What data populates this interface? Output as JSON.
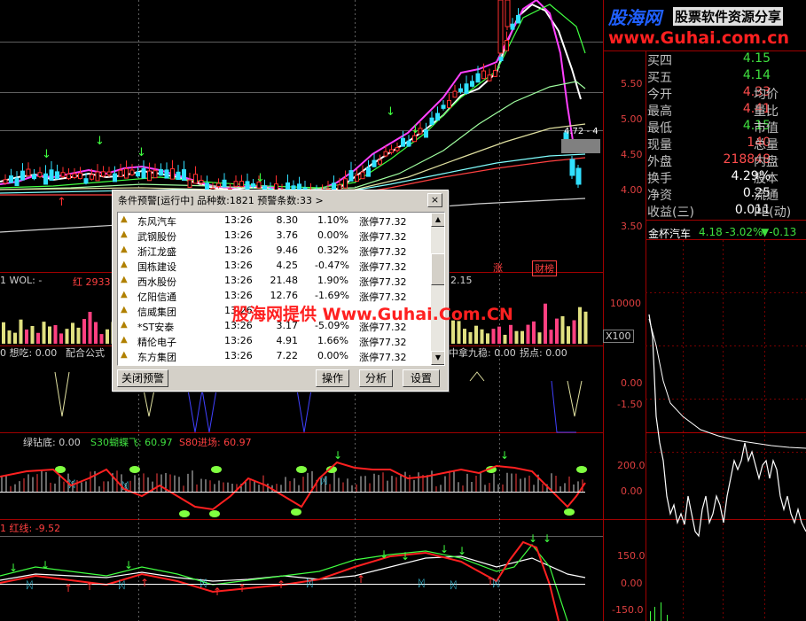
{
  "brand": {
    "logo_main": "股海网",
    "logo_sub": "股票软件资源分享",
    "url": "www.Guhai.com.cn",
    "watermark": "股海网提供 Www.Guhai.Com.CN"
  },
  "price_axis": [
    "5.50",
    "5.00",
    "4.50",
    "4.00",
    "3.50"
  ],
  "price_tag": "4.72 - 4",
  "volume_axis": [
    "10000",
    "X100"
  ],
  "vol_label": "1 WOL: -",
  "vol_red_label": "红 2933",
  "vol_right_value": "2.15",
  "tag_zhang": "涨",
  "tag_caifubang": "财榜",
  "ind1": {
    "label1": "0 想吃: 0.00",
    "label2": "配合公式",
    "label_right_a": "中拿九稳: 0.00",
    "label_right_b": "拐点: 0.00",
    "axis": [
      "0.00",
      "-1.50"
    ]
  },
  "ind2": {
    "label1": "绿钻底: 0.00",
    "label2": "S30蝴蝶飞: 60.97",
    "label3": "S80进场: 60.97",
    "axis": [
      "200.0",
      "0.00"
    ]
  },
  "ind3": {
    "label1": "1 红线: -9.52",
    "axis": [
      "150.0",
      "0.00",
      "-150.0"
    ]
  },
  "quote": {
    "rows": [
      {
        "k": "买四",
        "v": "4.15",
        "vc": "green",
        "k2": "",
        "v2": ""
      },
      {
        "k": "买五",
        "v": "4.14",
        "vc": "green",
        "k2": "",
        "v2": ""
      },
      {
        "k": "今开",
        "v": "4.33",
        "vc": "red",
        "k2": "均价",
        "v2": ""
      },
      {
        "k": "最高",
        "v": "4.41",
        "vc": "red",
        "k2": "量比",
        "v2": ""
      },
      {
        "k": "最低",
        "v": "4.15",
        "vc": "green",
        "k2": "市值",
        "v2": ""
      },
      {
        "k": "现量",
        "v": "140",
        "vc": "red",
        "k2": "总量",
        "v2": ""
      },
      {
        "k": "外盘",
        "v": "218848",
        "vc": "red",
        "k2": "内盘",
        "v2": ""
      },
      {
        "k": "换手",
        "v": "4.29%",
        "vc": "white",
        "k2": "股本",
        "v2": ""
      },
      {
        "k": "净资",
        "v": "0.25",
        "vc": "white",
        "k2": "流通",
        "v2": ""
      },
      {
        "k": "收益(三)",
        "v": "0.011",
        "vc": "white",
        "k2": "PE(动)",
        "v2": ""
      }
    ],
    "mini_title": "金杯汽车",
    "mini_price": "4.18",
    "mini_change": "-3.02%",
    "mini_delta": "▼-0.13"
  },
  "dialog": {
    "title": "条件预警[运行中] 品种数:1821 预警条数:33  >",
    "close": "×",
    "rows": [
      {
        "name": "东风汽车",
        "time": "13:26",
        "price": "8.30",
        "pct": "1.10%",
        "cond": "涨停77.32"
      },
      {
        "name": "武钢股份",
        "time": "13:26",
        "price": "3.76",
        "pct": "0.00%",
        "cond": "涨停77.32"
      },
      {
        "name": "浙江龙盛",
        "time": "13:26",
        "price": "9.46",
        "pct": "0.32%",
        "cond": "涨停77.32"
      },
      {
        "name": "国栋建设",
        "time": "13:26",
        "price": "4.25",
        "pct": "-0.47%",
        "cond": "涨停77.32"
      },
      {
        "name": "西水股份",
        "time": "13:26",
        "price": "21.48",
        "pct": "1.90%",
        "cond": "涨停77.32"
      },
      {
        "name": "亿阳信通",
        "time": "13:26",
        "price": "12.76",
        "pct": "-1.69%",
        "cond": "涨停77.32"
      },
      {
        "name": "信威集团",
        "time": "13:26",
        "price": "",
        "pct": "",
        "cond": ""
      },
      {
        "name": "*ST安泰",
        "time": "13:26",
        "price": "3.17",
        "pct": "-5.09%",
        "cond": "涨停77.32"
      },
      {
        "name": "精伦电子",
        "time": "13:26",
        "price": "4.91",
        "pct": "1.66%",
        "cond": "涨停77.32"
      },
      {
        "name": "东方集团",
        "time": "13:26",
        "price": "7.22",
        "pct": "0.00%",
        "cond": "涨停77.32"
      }
    ],
    "btn_close": "关闭预警",
    "btn_op": "操作",
    "btn_analyze": "分析",
    "btn_settings": "设置"
  },
  "colors": {
    "up": "#ff3030",
    "down": "#30e0ff",
    "ma_white": "#ffffff",
    "ma_magenta": "#ff40ff",
    "ma_green": "#40ff40",
    "grid_red": "#a00000"
  }
}
